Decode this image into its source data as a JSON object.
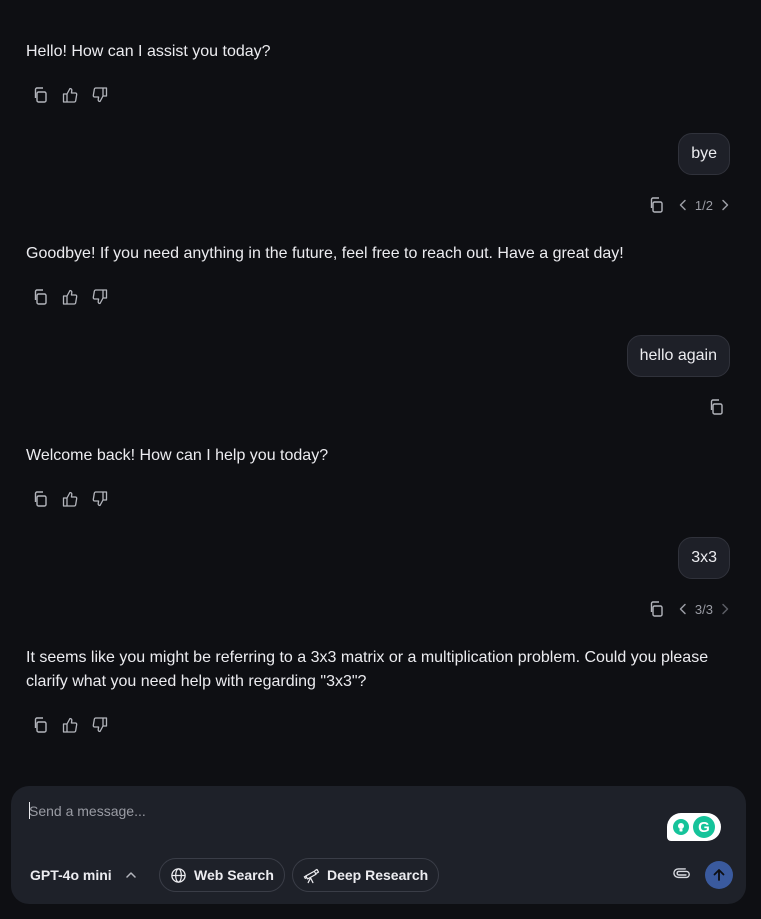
{
  "messages": [
    {
      "role": "assistant",
      "text": "Hello! How can I assist you today?"
    },
    {
      "role": "user",
      "text": "bye",
      "pager": "1/2"
    },
    {
      "role": "assistant",
      "text": "Goodbye! If you need anything in the future, feel free to reach out. Have a great day!"
    },
    {
      "role": "user",
      "text": "hello again"
    },
    {
      "role": "assistant",
      "text": "Welcome back! How can I help you today?"
    },
    {
      "role": "user",
      "text": "3x3",
      "pager": "3/3"
    },
    {
      "role": "assistant",
      "text": "It seems like you might be referring to a 3x3 matrix or a multiplication problem. Could you please clarify what you need help with regarding \"3x3\"?"
    }
  ],
  "composer": {
    "placeholder": "Send a message...",
    "model": "GPT-4o mini",
    "web_search": "Web Search",
    "deep_research": "Deep Research"
  },
  "icons": {
    "copy": "copy-icon",
    "like": "thumbs-up-icon",
    "dislike": "thumbs-down-icon",
    "prev": "chevron-left-icon",
    "next": "chevron-right-icon",
    "model": "chevron-up-icon",
    "web": "globe-icon",
    "deep": "telescope-icon",
    "attach": "paperclip-icon",
    "send": "arrow-up-icon",
    "grammarly": "grammarly-icon"
  },
  "colors": {
    "background": "#0e0f13",
    "composer": "#1e2129",
    "bubble": "#1e2028",
    "send": "#3a5a9e",
    "grammarly": "#15c39a"
  }
}
